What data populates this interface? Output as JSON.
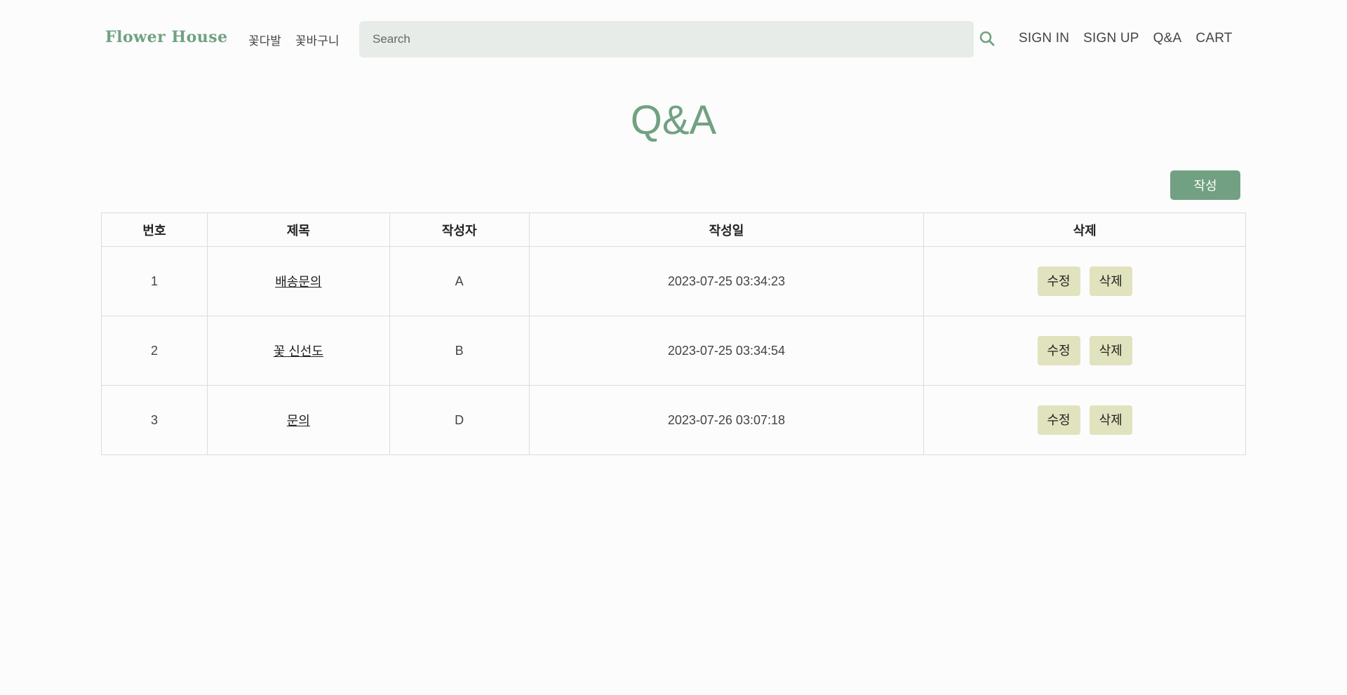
{
  "header": {
    "logo": "Flower House",
    "nav_left": [
      "꽃다발",
      "꽃바구니"
    ],
    "search": {
      "placeholder": "Search",
      "value": ""
    },
    "nav_right": [
      "SIGN IN",
      "SIGN UP",
      "Q&A",
      "CART"
    ]
  },
  "page": {
    "title": "Q&A",
    "write_button": "작성"
  },
  "table": {
    "headers": [
      "번호",
      "제목",
      "작성자",
      "작성일",
      "삭제"
    ],
    "rows": [
      {
        "no": "1",
        "title": "배송문의",
        "writer": "A",
        "date": "2023-07-25 03:34:23",
        "edit": "수정",
        "delete": "삭제"
      },
      {
        "no": "2",
        "title": "꽃 신선도",
        "writer": "B",
        "date": "2023-07-25 03:34:54",
        "edit": "수정",
        "delete": "삭제"
      },
      {
        "no": "3",
        "title": "문의",
        "writer": "D",
        "date": "2023-07-26 03:07:18",
        "edit": "수정",
        "delete": "삭제"
      }
    ]
  },
  "colors": {
    "accent": "#71a182",
    "search_bg": "#e7ece8",
    "row_button_bg": "#e0e3bd"
  },
  "icons": {
    "search": "search-icon"
  }
}
